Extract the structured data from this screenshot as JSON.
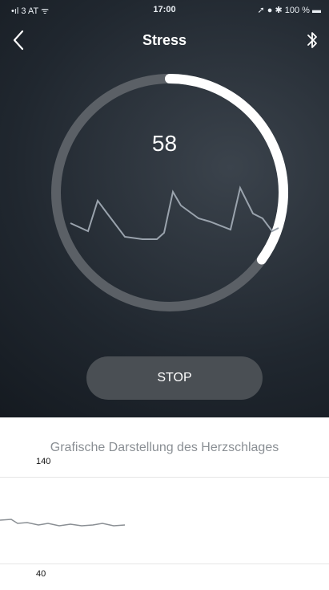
{
  "status_bar": {
    "carrier": "3 AT",
    "time": "17:00",
    "battery": "100 %"
  },
  "nav": {
    "title": "Stress",
    "back_icon": "chevron-left-icon",
    "bluetooth_icon": "bluetooth-icon"
  },
  "stress": {
    "value": "58",
    "progress": 0.35
  },
  "actions": {
    "stop_label": "STOP"
  },
  "heart_rate_chart": {
    "title": "Grafische Darstellung des Herzschlages",
    "y_max_label": "140",
    "y_min_label": "40"
  },
  "colors": {
    "ring_track": "#5b6066",
    "ring_progress": "#ffffff",
    "stop_button": "#4a4f54"
  }
}
